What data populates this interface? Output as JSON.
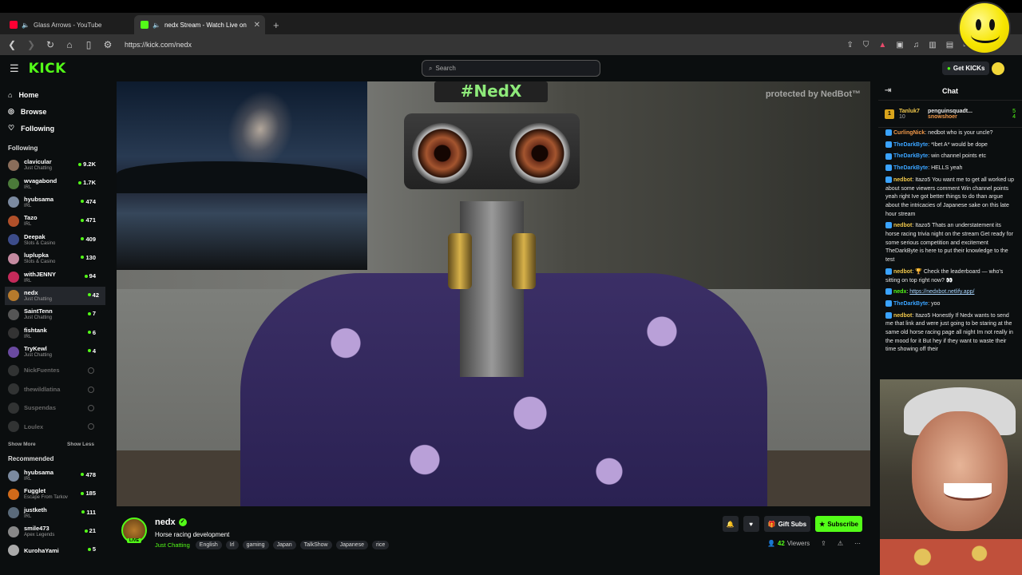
{
  "browser": {
    "tabs": [
      {
        "title": "Glass Arrows - YouTube",
        "color": "#ff0033"
      },
      {
        "title": "nedx Stream - Watch Live on",
        "color": "#53fc18"
      }
    ],
    "new_tab": "+",
    "url": "https://kick.com/nedx"
  },
  "header": {
    "logo": "KICK",
    "search_placeholder": "Search",
    "get_kicks": "Get KICKs"
  },
  "sidebar": {
    "nav": [
      {
        "label": "Home",
        "icon": "home-icon"
      },
      {
        "label": "Browse",
        "icon": "compass-icon"
      },
      {
        "label": "Following",
        "icon": "heart-icon"
      }
    ],
    "following_title": "Following",
    "following": [
      {
        "name": "clavicular",
        "cat": "Just Chatting",
        "count": "9.2K",
        "color": "#8a6d5a"
      },
      {
        "name": "wvagabond",
        "cat": "IRL",
        "count": "1.7K",
        "color": "#4b7a3a"
      },
      {
        "name": "hyubsama",
        "cat": "IRL",
        "count": "474",
        "color": "#7b8aa0"
      },
      {
        "name": "Tazo",
        "cat": "IRL",
        "count": "471",
        "color": "#b0502a"
      },
      {
        "name": "Deepak",
        "cat": "Slots & Casino",
        "count": "409",
        "color": "#3c4c8a"
      },
      {
        "name": "luplupka",
        "cat": "Slots & Casino",
        "count": "130",
        "color": "#c48aa0"
      },
      {
        "name": "withJENNY",
        "cat": "IRL",
        "count": "94",
        "color": "#c42a5a"
      },
      {
        "name": "nedx",
        "cat": "Just Chatting",
        "count": "42",
        "color": "#b67a2c"
      },
      {
        "name": "SaintTenn",
        "cat": "Just Chatting",
        "count": "7",
        "color": "#555"
      },
      {
        "name": "fishtank",
        "cat": "IRL",
        "count": "6",
        "color": "#333"
      },
      {
        "name": "TryKewl",
        "cat": "Just Chatting",
        "count": "4",
        "color": "#6a4aa0"
      }
    ],
    "offline": [
      "NickFuentes",
      "thewildlatina",
      "Suspendas",
      "Loulex"
    ],
    "show_more": "Show More",
    "show_less": "Show Less",
    "recommended_title": "Recommended",
    "recommended": [
      {
        "name": "hyubsama",
        "cat": "IRL",
        "count": "478",
        "color": "#7b8aa0"
      },
      {
        "name": "Fugglet",
        "cat": "Escape From Tarkov",
        "count": "185",
        "color": "#d06a1a"
      },
      {
        "name": "justketh",
        "cat": "IRL",
        "count": "111",
        "color": "#5a6a7a"
      },
      {
        "name": "smile473",
        "cat": "Apex Legends",
        "count": "21",
        "color": "#888"
      },
      {
        "name": "KurohaYami",
        "cat": "",
        "count": "5",
        "color": "#aaa"
      }
    ]
  },
  "video": {
    "sign_text": "#NedX",
    "watermark": "protected by NedBot™"
  },
  "chat": {
    "title": "Chat",
    "leaderboard": {
      "rank": "1",
      "user1": "Tanluk7",
      "user1_sub": "10",
      "user2": "penguinsquadt...",
      "user2_count": "5",
      "user3": "snowshoer",
      "user3_count": "4"
    },
    "messages": [
      {
        "user": "CurlingNick",
        "color": "#f2994a",
        "text": "nedbot who is your uncle?"
      },
      {
        "user": "TheDarkByte",
        "color": "#3aa3ff",
        "text": "*Ibet A* would be dope"
      },
      {
        "user": "TheDarkByte",
        "color": "#3aa3ff",
        "text": "win channel points etc"
      },
      {
        "user": "TheDarkByte",
        "color": "#3aa3ff",
        "text": "HELLS yeah"
      },
      {
        "user": "nedbot",
        "color": "#f2c94c",
        "text": "Itazo5 You want me to get all worked up about some viewers comment Win channel points yeah right Ive got better things to do than argue about the intricacies of Japanese sake on this late hour stream"
      },
      {
        "user": "nedbot",
        "color": "#f2c94c",
        "text": "Itazo5 Thats an understatement its horse racing trivia night on the stream Get ready for some serious competition and excitement TheDarkByte is here to put their knowledge to the test"
      },
      {
        "user": "nedbot",
        "color": "#f2c94c",
        "text": "🏆 Check the leaderboard — who's sitting on top right now? 👀"
      },
      {
        "user": "nedx",
        "color": "#53fc18",
        "text": "https://nedxbot.netlify.app/",
        "link": true
      },
      {
        "user": "TheDarkByte",
        "color": "#3aa3ff",
        "text": "yoo"
      },
      {
        "user": "nedbot",
        "color": "#f2c94c",
        "text": "Itazo5 Honestly If Nedx wants to send me that link and were just going to be staring at the same old horse racing page all night Im not really in the mood for it But hey if they want to waste their time showing off their"
      }
    ]
  },
  "stream": {
    "name": "nedx",
    "live": "LIVE",
    "title": "Horse racing development",
    "category": "Just Chatting",
    "tags": [
      "English",
      "Irl",
      "gaming",
      "Japan",
      "TalkShow",
      "Japanese",
      "rice"
    ],
    "gift_subs": "Gift Subs",
    "subscribe": "Subscribe",
    "viewers_count": "42",
    "viewers_label": "Viewers"
  }
}
